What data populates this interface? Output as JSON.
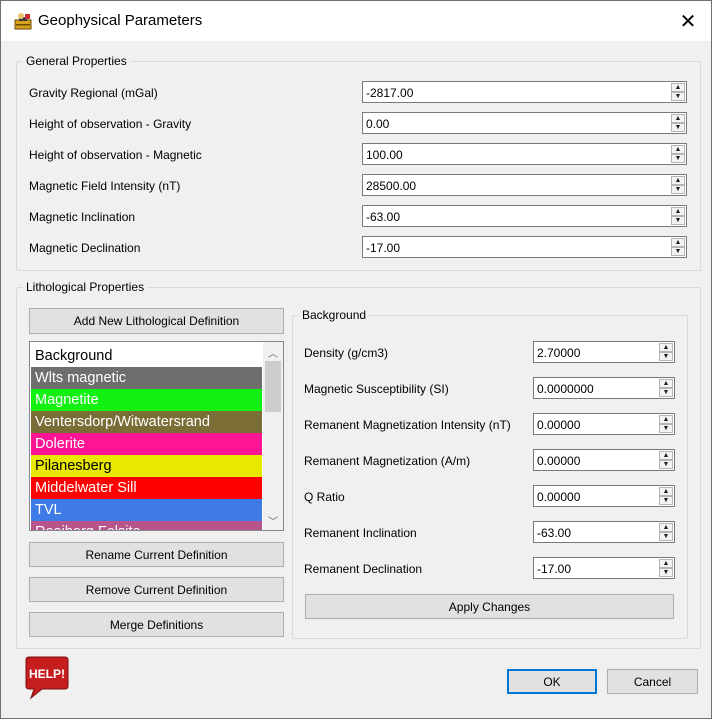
{
  "window": {
    "title": "Geophysical Parameters"
  },
  "general": {
    "title": "General Properties",
    "fields": [
      {
        "label": "Gravity Regional (mGal)",
        "value": "-2817.00"
      },
      {
        "label": "Height of observation - Gravity",
        "value": "0.00"
      },
      {
        "label": "Height of observation - Magnetic",
        "value": "100.00"
      },
      {
        "label": "Magnetic Field Intensity (nT)",
        "value": "28500.00"
      },
      {
        "label": "Magnetic Inclination",
        "value": "-63.00"
      },
      {
        "label": "Magnetic Declination",
        "value": "-17.00"
      }
    ]
  },
  "litho": {
    "title": "Lithological Properties",
    "add_button": "Add New Lithological Definition",
    "items": [
      {
        "label": "Background",
        "color": "#ffffff",
        "text_color": "#000000"
      },
      {
        "label": "Wlts magnetic",
        "color": "#6e6e6e",
        "text_color": "#ffffff"
      },
      {
        "label": "Magnetite",
        "color": "#12f112",
        "text_color": "#ffffff"
      },
      {
        "label": "Ventersdorp/Witwatersrand",
        "color": "#7a6d36",
        "text_color": "#ffffff"
      },
      {
        "label": "Dolerite",
        "color": "#ff1493",
        "text_color": "#ffffff"
      },
      {
        "label": "Pilanesberg",
        "color": "#e8e800",
        "text_color": "#000000"
      },
      {
        "label": "Middelwater Sill",
        "color": "#ff0000",
        "text_color": "#ffffff"
      },
      {
        "label": "TVL",
        "color": "#3f7be6",
        "text_color": "#ffffff"
      },
      {
        "label": "Rooiberg Felsite",
        "color": "#b8548c",
        "text_color": "#ffffff"
      }
    ],
    "rename_button": "Rename Current Definition",
    "remove_button": "Remove Current Definition",
    "merge_button": "Merge Definitions",
    "detail": {
      "title": "Background",
      "fields": [
        {
          "label": "Density (g/cm3)",
          "value": "2.70000"
        },
        {
          "label": "Magnetic Susceptibility (SI)",
          "value": "0.0000000"
        },
        {
          "label": "Remanent Magnetization Intensity (nT)",
          "value": "0.00000"
        },
        {
          "label": "Remanent Magnetization (A/m)",
          "value": "0.00000"
        },
        {
          "label": "Q Ratio",
          "value": "0.00000"
        },
        {
          "label": "Remanent Inclination",
          "value": "-63.00"
        },
        {
          "label": "Remanent Declination",
          "value": "-17.00"
        }
      ],
      "apply_button": "Apply Changes"
    }
  },
  "footer": {
    "help_text": "HELP!",
    "ok_button": "OK",
    "cancel_button": "Cancel"
  },
  "icons": {
    "app": "toolbox-icon",
    "close": "close-icon",
    "spin_up": "up-arrow-icon",
    "spin_down": "down-arrow-icon",
    "help": "help-badge-icon"
  }
}
